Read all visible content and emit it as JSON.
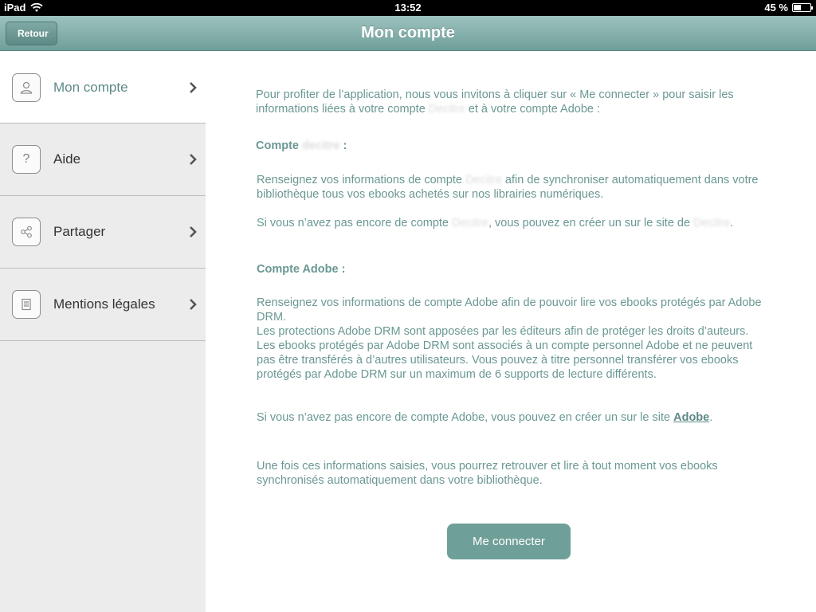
{
  "status": {
    "device": "iPad",
    "time": "13:52",
    "battery": "45 %",
    "battery_level": 0.45
  },
  "nav": {
    "title": "Mon compte",
    "back_label": "Retour"
  },
  "sidebar": {
    "items": [
      {
        "label": "Mon compte",
        "icon": "user-icon"
      },
      {
        "label": "Aide",
        "icon": "question-icon"
      },
      {
        "label": "Partager",
        "icon": "share-icon"
      },
      {
        "label": "Mentions légales",
        "icon": "document-icon"
      }
    ]
  },
  "content": {
    "intro_a": "Pour profiter de l’application, nous vous invitons à cliquer sur « Me connecter » pour saisir les informations liées à votre compte",
    "intro_blur": "Decitre",
    "intro_b": "et à votre compte Adobe :",
    "section1_title_a": "Compte",
    "section1_title_blur": "decitre",
    "section1_title_b": ":",
    "s1p1_a": "Renseignez vos informations de compte",
    "s1p1_blur": "Decitre",
    "s1p1_b": "afin de synchroniser automatiquement dans votre bibliothèque tous vos ebooks achetés sur nos librairies numériques.",
    "s1p2_a": "Si vous n’avez pas encore de compte",
    "s1p2_blur1": "Decitre",
    "s1p2_b": ", vous pouvez en créer un sur le site de",
    "s1p2_blur2": "Decitre",
    "s1p2_c": ".",
    "section2_title": "Compte Adobe :",
    "s2p1": "Renseignez vos informations de compte Adobe afin de pouvoir lire vos ebooks protégés par Adobe DRM.",
    "s2p2": "Les protections Adobe DRM sont apposées par les éditeurs afin de protéger les droits d’auteurs. Les ebooks protégés par Adobe DRM sont associés à un compte personnel Adobe et ne peuvent pas être transférés à d’autres utilisateurs. Vous pouvez à titre personnel transférer vos ebooks protégés par Adobe DRM sur un maximum de 6 supports de lecture différents.",
    "s2p3_a": "Si vous n’avez pas encore de compte Adobe, vous pouvez en créer un sur le site",
    "s2p3_link": "Adobe",
    "s2p3_b": ".",
    "outro": "Une fois ces informations saisies, vous pourrez retrouver et lire à tout moment vos ebooks synchronisés automatiquement dans votre bibliothèque.",
    "connect_label": "Me connecter"
  },
  "colors": {
    "accent": "#6f9f99",
    "text": "#6a9893",
    "sidebar_bg": "#ececec"
  }
}
